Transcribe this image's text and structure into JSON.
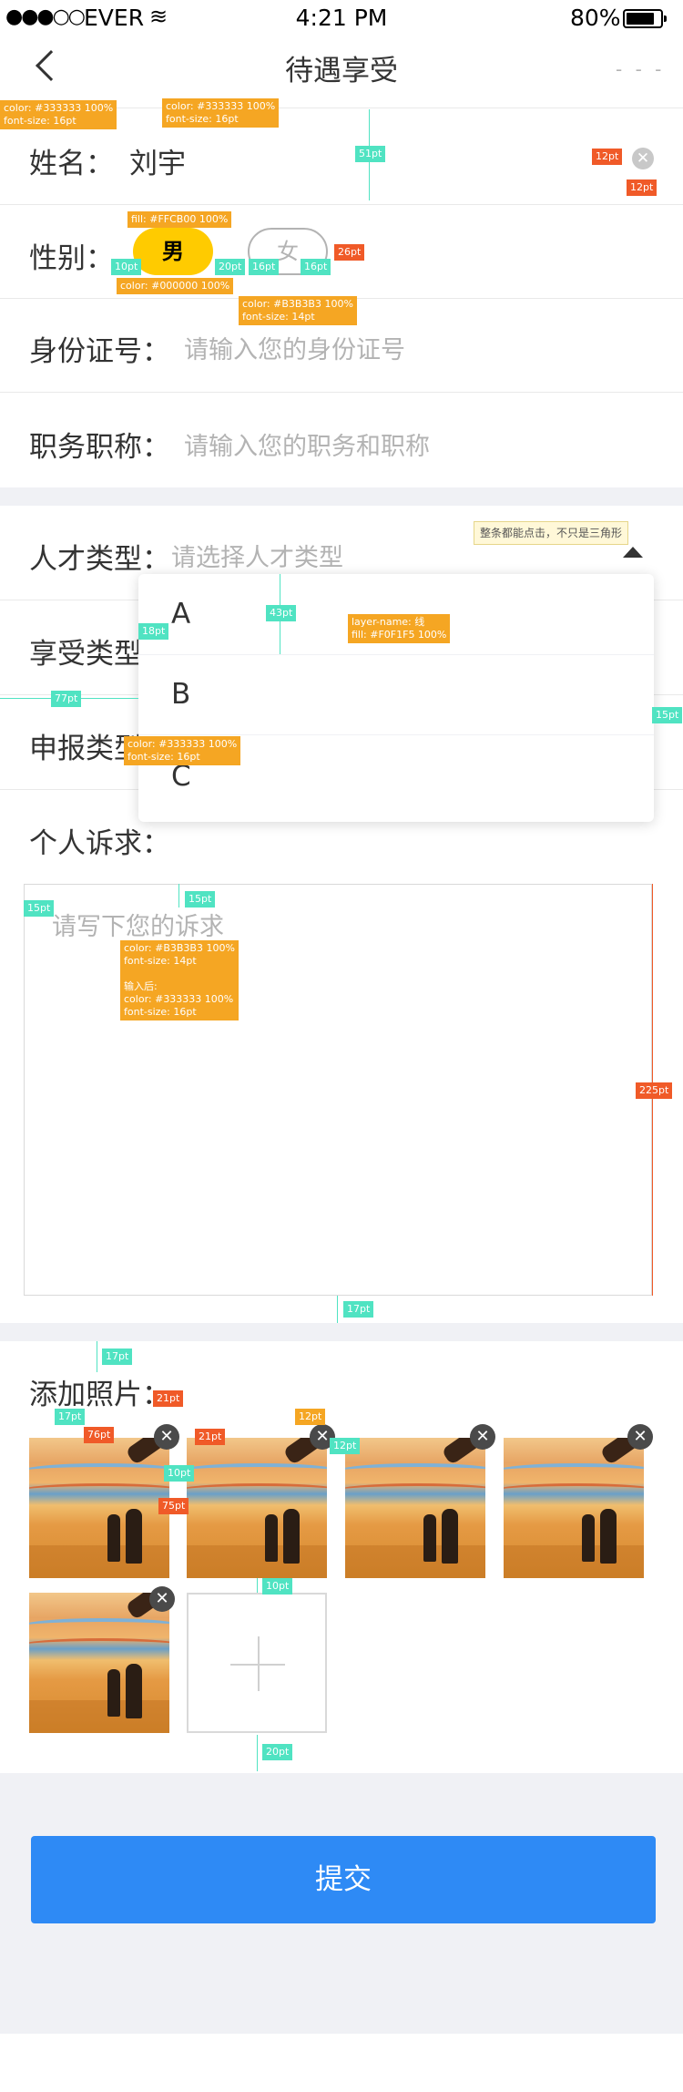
{
  "status_bar": {
    "signal": "●●●○○",
    "carrier": "EVER",
    "wifi": "wifi",
    "time": "4:21 PM",
    "battery_text": "80%",
    "battery_level": 0.8
  },
  "nav": {
    "title": "待遇享受",
    "back_icon": "chevron-left",
    "more": "- - -"
  },
  "form": {
    "name": {
      "label": "姓名：",
      "value": "刘宇"
    },
    "gender": {
      "label": "性别：",
      "male": "男",
      "female": "女",
      "selected": "男"
    },
    "id_card": {
      "label": "身份证号：",
      "placeholder": "请输入您的身份证号"
    },
    "job_title": {
      "label": "职务职称：",
      "placeholder": "请输入您的职务和职称"
    },
    "talent_type": {
      "label": "人才类型：",
      "placeholder": "请选择人才类型",
      "options": [
        "A",
        "B",
        "C"
      ]
    },
    "enjoy_type": {
      "label": "享受类型"
    },
    "declare_type": {
      "label": "申报类型"
    },
    "appeal": {
      "label": "个人诉求：",
      "placeholder": "请写下您的诉求"
    },
    "photos": {
      "label": "添加照片："
    },
    "submit_label": "提交"
  },
  "annotations": {
    "tip": "整条都能点击，不只是三角形",
    "a1": "color: #333333 100%\nfont-size: 16pt",
    "a2": "color: #333333 100%\nfont-size: 16pt",
    "a3": "fill: #FFCB00 100%",
    "a4": "color: #000000 100%",
    "a5": "color: #B3B3B3 100%\nfont-size: 14pt",
    "a6": "layer-name: 线\nfill: #F0F1F5 100%",
    "a7": "color: #333333 100%\nfont-size: 16pt",
    "a8": "color: #B3B3B3 100%\nfont-size: 14pt\n\n输入后:\ncolor: #333333 100%\nfont-size: 16pt",
    "d51": "51pt",
    "d12a": "12pt",
    "d12b": "12pt",
    "d10a": "10pt",
    "d20a": "20pt",
    "d16a": "16pt",
    "d16b": "16pt",
    "d26": "26pt",
    "d43": "43pt",
    "d18": "18pt",
    "d77": "77pt",
    "d15a": "15pt",
    "d15b": "15pt",
    "d15c": "15pt",
    "d225": "225pt",
    "d17a": "17pt",
    "d17b": "17pt",
    "d17c": "17pt",
    "d21a": "21pt",
    "d21b": "21pt",
    "d76": "76pt",
    "d75": "75pt",
    "d10b": "10pt",
    "d12c": "12pt",
    "d12d": "12pt",
    "d10c": "10pt",
    "d20b": "20pt"
  },
  "colors": {
    "accent": "#2E8AF5",
    "pill": "#FFCB00",
    "placeholder": "#B3B3B3",
    "text": "#333333",
    "section_bg": "#F0F1F5"
  }
}
